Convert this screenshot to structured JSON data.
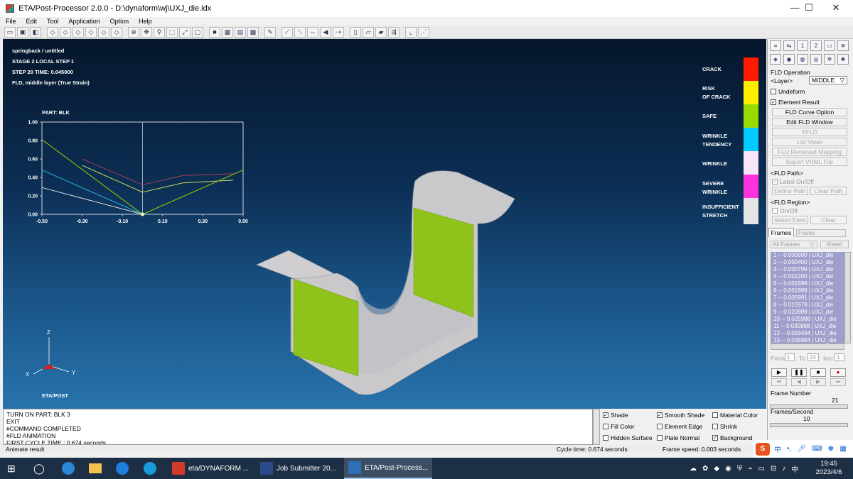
{
  "window": {
    "title": "ETA/Post-Processor 2.0.0 - D:\\dynaform\\wj\\UXJ_die.idx",
    "minimize": "—",
    "maximize": "☐",
    "close": "✕"
  },
  "menu": [
    "File",
    "Edit",
    "Tool",
    "Application",
    "Option",
    "Help"
  ],
  "viewport": {
    "info": [
      "springback / untitled",
      "STAGE 2  LOCAL STEP 1",
      "STEP 20   TIME:    0.045000",
      "FLD, middle layer (True Strain)"
    ],
    "logo": "ETA/POST",
    "axes": {
      "z": "Z",
      "x": "X",
      "y": "Y"
    },
    "legend": [
      {
        "label": "CRACK",
        "color": "#ff1a00"
      },
      {
        "label": "RISK\nOF CRACK",
        "color": "#ffee00"
      },
      {
        "label": "SAFE",
        "color": "#99dd00"
      },
      {
        "label": "WRINKLE\nTENDENCY",
        "color": "#00ccff"
      },
      {
        "label": "WRINKLE",
        "color": "#f8e6f8"
      },
      {
        "label": "SEVERE\nWRINKLE",
        "color": "#ff33dd"
      },
      {
        "label": "INSUFFICIENT\nSTRETCH",
        "color": "#e4e4e4"
      }
    ]
  },
  "chart_data": {
    "type": "line",
    "title": "PART:   BLK",
    "xlim": [
      -0.5,
      0.5
    ],
    "ylim": [
      0,
      1.0
    ],
    "xticks": [
      "-0.50",
      "-0.30",
      "-0.10",
      "0.10",
      "0.30",
      "0.50"
    ],
    "yticks": [
      "0.00",
      "0.20",
      "0.40",
      "0.60",
      "0.80",
      "1.00"
    ],
    "series": [
      {
        "color": "#ab3a5c",
        "x": [
          -0.3,
          0.0,
          0.2,
          0.45
        ],
        "y": [
          0.6,
          0.32,
          0.42,
          0.44
        ]
      },
      {
        "color": "#c8e060",
        "x": [
          -0.3,
          0.0,
          0.2,
          0.45
        ],
        "y": [
          0.53,
          0.24,
          0.34,
          0.37
        ]
      },
      {
        "color": "#9ad000",
        "x": [
          -0.5,
          0.0,
          0.5
        ],
        "y": [
          0.81,
          0.0,
          0.48
        ]
      },
      {
        "color": "#2ab0e8",
        "x": [
          -0.5,
          0.0
        ],
        "y": [
          0.48,
          0.0
        ]
      },
      {
        "color": "#dcdcdc",
        "x": [
          -0.5,
          0.0
        ],
        "y": [
          0.29,
          0.0
        ]
      }
    ],
    "points": [
      {
        "x": 0.0,
        "y": 0.0,
        "color": "#eeffaa"
      }
    ]
  },
  "console": [
    "TURN ON PART: BLK    3",
    "EXIT",
    "#COMMAND COMPLETED",
    "#FLD ANIMATION",
    "FIRST CYCLE TIME :  0.674 seconds"
  ],
  "display_options": [
    {
      "label": "Shade",
      "checked": true
    },
    {
      "label": "Smooth Shade",
      "checked": true
    },
    {
      "label": "Material Color",
      "checked": false
    },
    {
      "label": "Fill Color",
      "checked": false
    },
    {
      "label": "Element Edge",
      "checked": false
    },
    {
      "label": "Shrink",
      "checked": false
    },
    {
      "label": "Hidden Surface",
      "checked": false
    },
    {
      "label": "Plate Normal",
      "checked": false
    },
    {
      "label": "Background",
      "checked": true
    }
  ],
  "status": {
    "left": "Animate result",
    "cycle_time": "Cycle time:  0.674 seconds",
    "frame_speed": "Frame speed:  0.003 seconds"
  },
  "right_panel": {
    "heading": "FLD Operation",
    "layer_label": "<Layer>",
    "layer_value": "MIDDLE",
    "undeform": "Undeform",
    "element_result": "Element Result",
    "buttons": [
      "FLD Curve Option",
      "Edit FLD Window",
      "EFLD",
      "List Value",
      "FLD Reversed Mapping",
      "Export VRML File"
    ],
    "fld_path": "<FLD Path>",
    "label_onoff": "Label On/Off",
    "define_path": "Define Path",
    "clear_path": "Clear Path",
    "fld_region": "<FLD Region>",
    "onoff": "On/Off",
    "select_elem": "Select Elem",
    "clear": "Clear",
    "frames_tab": "Frames",
    "frame_select": "Frame",
    "all_frames": "All Frames",
    "reset": "Reset",
    "frames": [
      "1 -- 0.000000 | UXJ_die",
      "2 -- 0.000400 | UXJ_die",
      "3 -- 0.000799 | UXJ_die",
      "4 -- 0.001200 | UXJ_die",
      "5 -- 0.001599 | UXJ_die",
      "6 -- 0.001999 | UXJ_die",
      "7 -- 0.005991 | UXJ_die",
      "8 -- 0.015978 | UXJ_die",
      "9 -- 0.020989 | UXJ_die",
      "10 -- 0.025988 | UXJ_die",
      "11 -- 0.030988 | UXJ_die",
      "12 -- 0.033494 | UXJ_die",
      "13 -- 0.035994 | UXJ_die"
    ],
    "from_label": "From",
    "from_value": "1",
    "to_label": "To",
    "to_value": "24",
    "incr_label": "Incr",
    "incr_value": "1",
    "frame_number_label": "Frame Number",
    "frame_number": "21",
    "frames_per_second": "Frames/Second",
    "fps_value": "10"
  },
  "taskbar": {
    "apps": [
      {
        "label": "eta/DYNAFORM ...",
        "color": "#d23a2a"
      },
      {
        "label": "Job Submitter 20...",
        "color": "#2a4a88"
      },
      {
        "label": "ETA/Post-Process...",
        "color": "#2f6fb8"
      }
    ],
    "time": "19:45",
    "date": "2023/4/6",
    "ime": "中"
  }
}
